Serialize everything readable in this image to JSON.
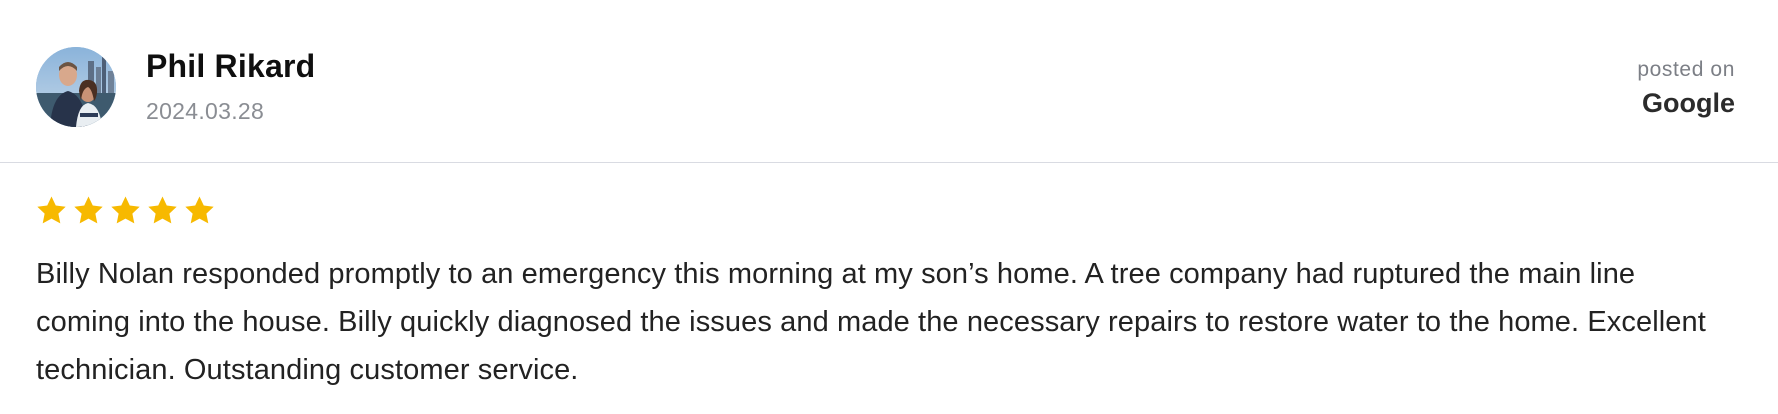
{
  "review": {
    "author_name": "Phil Rikard",
    "date": "2024.03.28",
    "posted_on_label": "posted on",
    "platform": "Google",
    "rating": 5,
    "rating_max": 5,
    "star_color": "#F7B900",
    "text": "Billy Nolan responded promptly to an emergency this morning at my son’s home. A tree company had ruptured the main line coming into the house. Billy quickly diagnosed the issues and made the necessary repairs to restore water to the home. Excellent technician. Outstanding customer service."
  },
  "icons": {
    "avatar": "avatar-photo",
    "star": "star-icon"
  }
}
